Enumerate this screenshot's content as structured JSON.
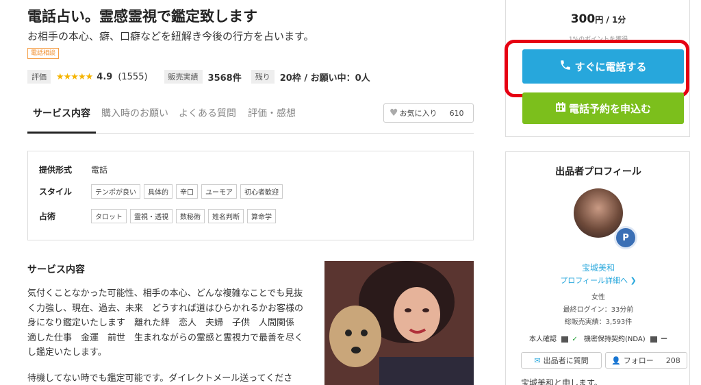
{
  "header": {
    "title": "電話占い。霊感霊視で鑑定致します",
    "subtitle": "お相手の本心、癖、口癖などを紐解き今後の行方を占います。",
    "tag": "電話相談"
  },
  "stats": {
    "rating_label": "評価",
    "stars": "★★★★★",
    "rating": "4.9",
    "rating_count": "(1555)",
    "sales_label": "販売実績",
    "sales_value": "3568件",
    "remaining_label": "残り",
    "remaining_value": "20枠 / お願い中：0人"
  },
  "tabs": [
    {
      "label": "サービス内容"
    },
    {
      "label": "購入時のお願い"
    },
    {
      "label": "よくある質問"
    },
    {
      "label": "評価・感想"
    }
  ],
  "favorite": {
    "label": "お気に入り",
    "count": "610"
  },
  "info": {
    "format_label": "提供形式",
    "format_value": "電話",
    "style_label": "スタイル",
    "styles": [
      "テンポが良い",
      "具体的",
      "辛口",
      "ユーモア",
      "初心者歓迎"
    ],
    "method_label": "占術",
    "methods": [
      "タロット",
      "霊視・透視",
      "数秘術",
      "姓名判断",
      "算命学"
    ]
  },
  "service": {
    "title": "サービス内容",
    "lines": [
      "気付くことなかった可能性、相手の本心、どんな複雑なことでも見抜",
      "く力強し、現在、過去、未来　どうすれば道はひらかれるかお客様の",
      "身になり鑑定いたします　離れた絆　恋人　夫婦　子供　人間関係",
      "適した仕事　金運　前世　生まれながらの霊感と霊視力で最善を尽く",
      "し鑑定いたします。"
    ],
    "line2": "待機してない時でも鑑定可能です。ダイレクトメール送ってくださ"
  },
  "price": {
    "amount": "300",
    "unit": "円 / 1分",
    "points": "1%のポイントを獲得"
  },
  "actions": {
    "call_label": "すぐに電話する",
    "reserve_label": "電話予約を申込む"
  },
  "profile": {
    "title": "出品者プロフィール",
    "badge": "P",
    "name": "宝城美和",
    "detail_link": "プロフィール詳細へ ❯",
    "gender": "女性",
    "last_login": "最終ログイン：33分前",
    "total_sales": "総販売実績：3,593件",
    "verify_label": "本人確認",
    "verify_mark": "✓",
    "nda_label": "機密保持契約(NDA)",
    "nda_mark": "ー",
    "ask_label": "出品者に質問",
    "follow_label": "フォロー",
    "follow_count": "208",
    "intro": "宝城美和と申します。"
  },
  "colors": {
    "call_blue": "#27a7dc",
    "reserve_green": "#7cbf1c",
    "highlight_red": "#e60012",
    "star_gold": "#f5b400"
  }
}
